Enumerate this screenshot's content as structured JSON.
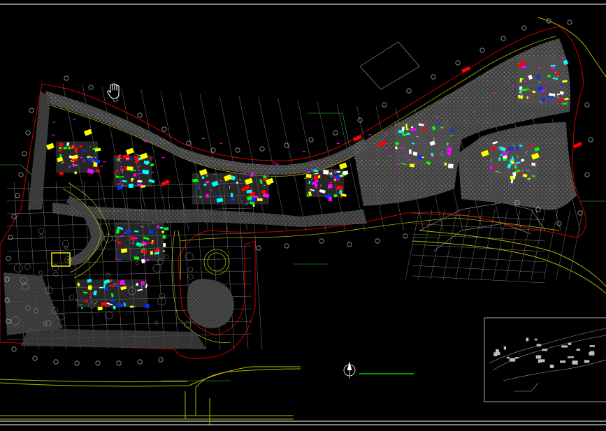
{
  "app": {
    "name": "",
    "cursor_icon": "pan-hand-icon"
  },
  "drawing": {
    "title": "",
    "scale": "",
    "subtitle": "",
    "inset_title": "",
    "inset_label_1": "",
    "inset_label_2": "",
    "callouts": [
      "",
      "",
      "",
      "",
      "",
      "",
      "",
      ""
    ]
  },
  "colors": {
    "background": "#000000",
    "boundary": "#cc0000",
    "road": "#b3b300",
    "grid": "#8a8a8a",
    "pavement": "#6d6d6d",
    "highlight_yellow": "#ffff00",
    "highlight_magenta": "#ff00ff",
    "highlight_cyan": "#00ffff",
    "highlight_red": "#ff0000",
    "highlight_green": "#00ff00",
    "highlight_blue": "#0033ff",
    "leader_green": "#33cc33"
  }
}
